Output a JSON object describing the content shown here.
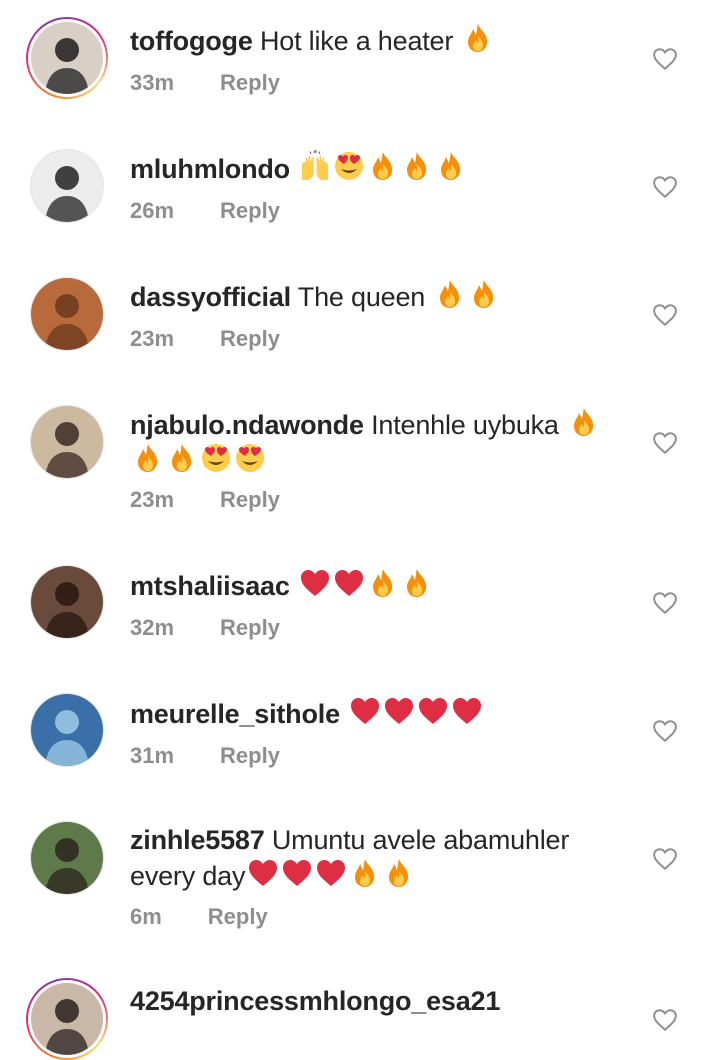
{
  "comments": [
    {
      "username": "toffogoge",
      "text": "Hot like a heater",
      "emojis": [
        "fire"
      ],
      "time": "33m",
      "reply": "Reply",
      "avatar": "story"
    },
    {
      "username": "mluhmlondo",
      "text": "",
      "emojis": [
        "raised-hands",
        "heart-eyes",
        "fire",
        "fire",
        "fire"
      ],
      "time": "26m",
      "reply": "Reply",
      "avatar": "plain"
    },
    {
      "username": "dassyofficial",
      "text": "The queen",
      "emojis": [
        "fire",
        "fire"
      ],
      "time": "23m",
      "reply": "Reply",
      "avatar": "plain"
    },
    {
      "username": "njabulo.ndawonde",
      "text": "Intenhle uybuka",
      "emojis": [
        "fire"
      ],
      "line2_emojis": [
        "fire",
        "fire",
        "heart-eyes",
        "heart-eyes"
      ],
      "time": "23m",
      "reply": "Reply",
      "avatar": "plain"
    },
    {
      "username": "mtshaliisaac",
      "text": "",
      "emojis": [
        "red-heart",
        "red-heart",
        "fire",
        "fire"
      ],
      "time": "32m",
      "reply": "Reply",
      "avatar": "plain"
    },
    {
      "username": "meurelle_sithole",
      "text": "",
      "emojis": [
        "red-heart",
        "red-heart",
        "red-heart",
        "red-heart"
      ],
      "time": "31m",
      "reply": "Reply",
      "avatar": "plain"
    },
    {
      "username": "zinhle5587",
      "text": "Umuntu avele abamuhler",
      "line2_text": "every day",
      "line2_emojis": [
        "red-heart",
        "red-heart",
        "red-heart",
        "fire",
        "fire"
      ],
      "time": "6m",
      "reply": "Reply",
      "avatar": "plain"
    },
    {
      "username": "4254princessmhlongo_esa21",
      "text": "",
      "emojis": [],
      "time": "",
      "reply": "",
      "avatar": "story"
    }
  ],
  "icons": {
    "like": "heart-outline-icon"
  }
}
